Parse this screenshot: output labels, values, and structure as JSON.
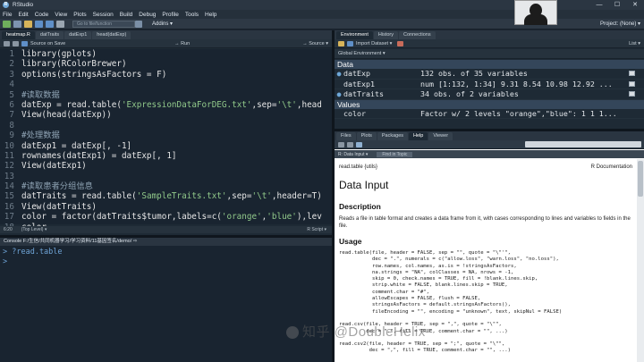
{
  "window": {
    "title": "RStudio",
    "controls": [
      "—",
      "☐",
      "✕"
    ]
  },
  "menu": [
    "File",
    "Edit",
    "Code",
    "View",
    "Plots",
    "Session",
    "Build",
    "Debug",
    "Profile",
    "Tools",
    "Help"
  ],
  "toolbar": {
    "goto": "Go to file/function",
    "addins": "Addins ▾",
    "project": "Project: (None) ▾"
  },
  "editor": {
    "tabs": [
      "heatmap.R",
      "datTraits",
      "datExp1",
      "head(datExp)"
    ],
    "toolbar": {
      "source_on_save": "Source on Save",
      "run": "→ Run",
      "source": "→ Source ▾"
    },
    "lines": [
      {
        "n": "1",
        "parts": [
          {
            "t": "library(gplots)",
            "c": "tx"
          }
        ]
      },
      {
        "n": "2",
        "parts": [
          {
            "t": "library(RColorBrewer)",
            "c": "tx"
          }
        ]
      },
      {
        "n": "3",
        "parts": [
          {
            "t": "options(stringsAsFactors = F)",
            "c": "tx"
          }
        ]
      },
      {
        "n": "4",
        "parts": []
      },
      {
        "n": "5",
        "parts": [
          {
            "t": "#读取数据",
            "c": "cm"
          }
        ]
      },
      {
        "n": "6",
        "parts": [
          {
            "t": "datExp = read.table(",
            "c": "tx"
          },
          {
            "t": "'ExpressionDataForDEG.txt'",
            "c": "st"
          },
          {
            "t": ",sep=",
            "c": "tx"
          },
          {
            "t": "'\\t'",
            "c": "st"
          },
          {
            "t": ",head",
            "c": "tx"
          }
        ]
      },
      {
        "n": "7",
        "parts": [
          {
            "t": "View(head(datExp))",
            "c": "tx"
          }
        ]
      },
      {
        "n": "8",
        "parts": []
      },
      {
        "n": "9",
        "parts": [
          {
            "t": "#处理数据",
            "c": "cm"
          }
        ]
      },
      {
        "n": "10",
        "parts": [
          {
            "t": "datExp1 = datExp[, -1]",
            "c": "tx"
          }
        ]
      },
      {
        "n": "11",
        "parts": [
          {
            "t": "rownames(datExp1) = datExp[, 1]",
            "c": "tx"
          }
        ]
      },
      {
        "n": "12",
        "parts": [
          {
            "t": "View(datExp1)",
            "c": "tx"
          }
        ]
      },
      {
        "n": "13",
        "parts": []
      },
      {
        "n": "14",
        "parts": [
          {
            "t": "#读取患者分组信息",
            "c": "cm"
          }
        ]
      },
      {
        "n": "15",
        "parts": [
          {
            "t": "datTraits = read.table(",
            "c": "tx"
          },
          {
            "t": "'SampleTraits.txt'",
            "c": "st"
          },
          {
            "t": ",sep=",
            "c": "tx"
          },
          {
            "t": "'\\t'",
            "c": "st"
          },
          {
            "t": ",header=T)",
            "c": "tx"
          }
        ]
      },
      {
        "n": "16",
        "parts": [
          {
            "t": "View(datTraits)",
            "c": "tx"
          }
        ]
      },
      {
        "n": "17",
        "parts": [
          {
            "t": "color = factor(datTraits$tumor,labels=c(",
            "c": "tx"
          },
          {
            "t": "'orange'",
            "c": "st"
          },
          {
            "t": ",",
            "c": "tx"
          },
          {
            "t": "'blue'",
            "c": "st"
          },
          {
            "t": "),lev",
            "c": "tx"
          }
        ]
      },
      {
        "n": "18",
        "parts": [
          {
            "t": "color",
            "c": "tx"
          }
        ]
      }
    ],
    "status": {
      "pos": "6:20",
      "scope": "(Top Level) ▾",
      "type": "R Script ▾"
    }
  },
  "console": {
    "title": "Console F:/生信/共同机器学习/学习资料/11基因签名/demo/ ⇨",
    "lines": [
      "> ?read.table",
      "> "
    ]
  },
  "environment": {
    "tabs": [
      "Environment",
      "History",
      "Connections"
    ],
    "toolbar": {
      "import": "Import Dataset ▾",
      "list": "List ▾"
    },
    "scope": "Global Environment ▾",
    "data_label": "Data",
    "values_label": "Values",
    "rows": [
      {
        "name": "datExp",
        "value": "132 obs. of 35 variables",
        "dot": "●"
      },
      {
        "name": "datExp1",
        "value": "num [1:132, 1:34] 9.31 8.54 10.98 12.92 ...",
        "dot": ""
      },
      {
        "name": "datTraits",
        "value": "34 obs. of 2 variables",
        "dot": "●"
      }
    ],
    "value_rows": [
      {
        "name": "color",
        "value": "Factor w/ 2 levels \"orange\",\"blue\": 1 1 1..."
      }
    ]
  },
  "help": {
    "tabs": [
      "Files",
      "Plots",
      "Packages",
      "Help",
      "Viewer"
    ],
    "crumb": [
      "R: Data Input ▾",
      "Find in Topic"
    ],
    "header_left": "read.table {utils}",
    "header_right": "R Documentation",
    "title": "Data Input",
    "description_h": "Description",
    "description": "Reads a file in table format and creates a data frame from it, with cases corresponding to lines and variables to fields in the file.",
    "usage_h": "Usage",
    "usage": "read.table(file, header = FALSE, sep = \"\", quote = \"\\\"'\",\n           dec = \".\", numerals = c(\"allow.loss\", \"warn.loss\", \"no.loss\"),\n           row.names, col.names, as.is = !stringsAsFactors,\n           na.strings = \"NA\", colClasses = NA, nrows = -1,\n           skip = 0, check.names = TRUE, fill = !blank.lines.skip,\n           strip.white = FALSE, blank.lines.skip = TRUE,\n           comment.char = \"#\",\n           allowEscapes = FALSE, flush = FALSE,\n           stringsAsFactors = default.stringsAsFactors(),\n           fileEncoding = \"\", encoding = \"unknown\", text, skipNul = FALSE)\n\nread.csv(file, header = TRUE, sep = \",\", quote = \"\\\"\",\n         dec = \".\", fill = TRUE, comment.char = \"\", ...)\n\nread.csv2(file, header = TRUE, sep = \";\", quote = \"\\\"\",\n          dec = \",\", fill = TRUE, comment.char = \"\", ...)"
  },
  "watermark": "知乎 @DoubleHelix"
}
